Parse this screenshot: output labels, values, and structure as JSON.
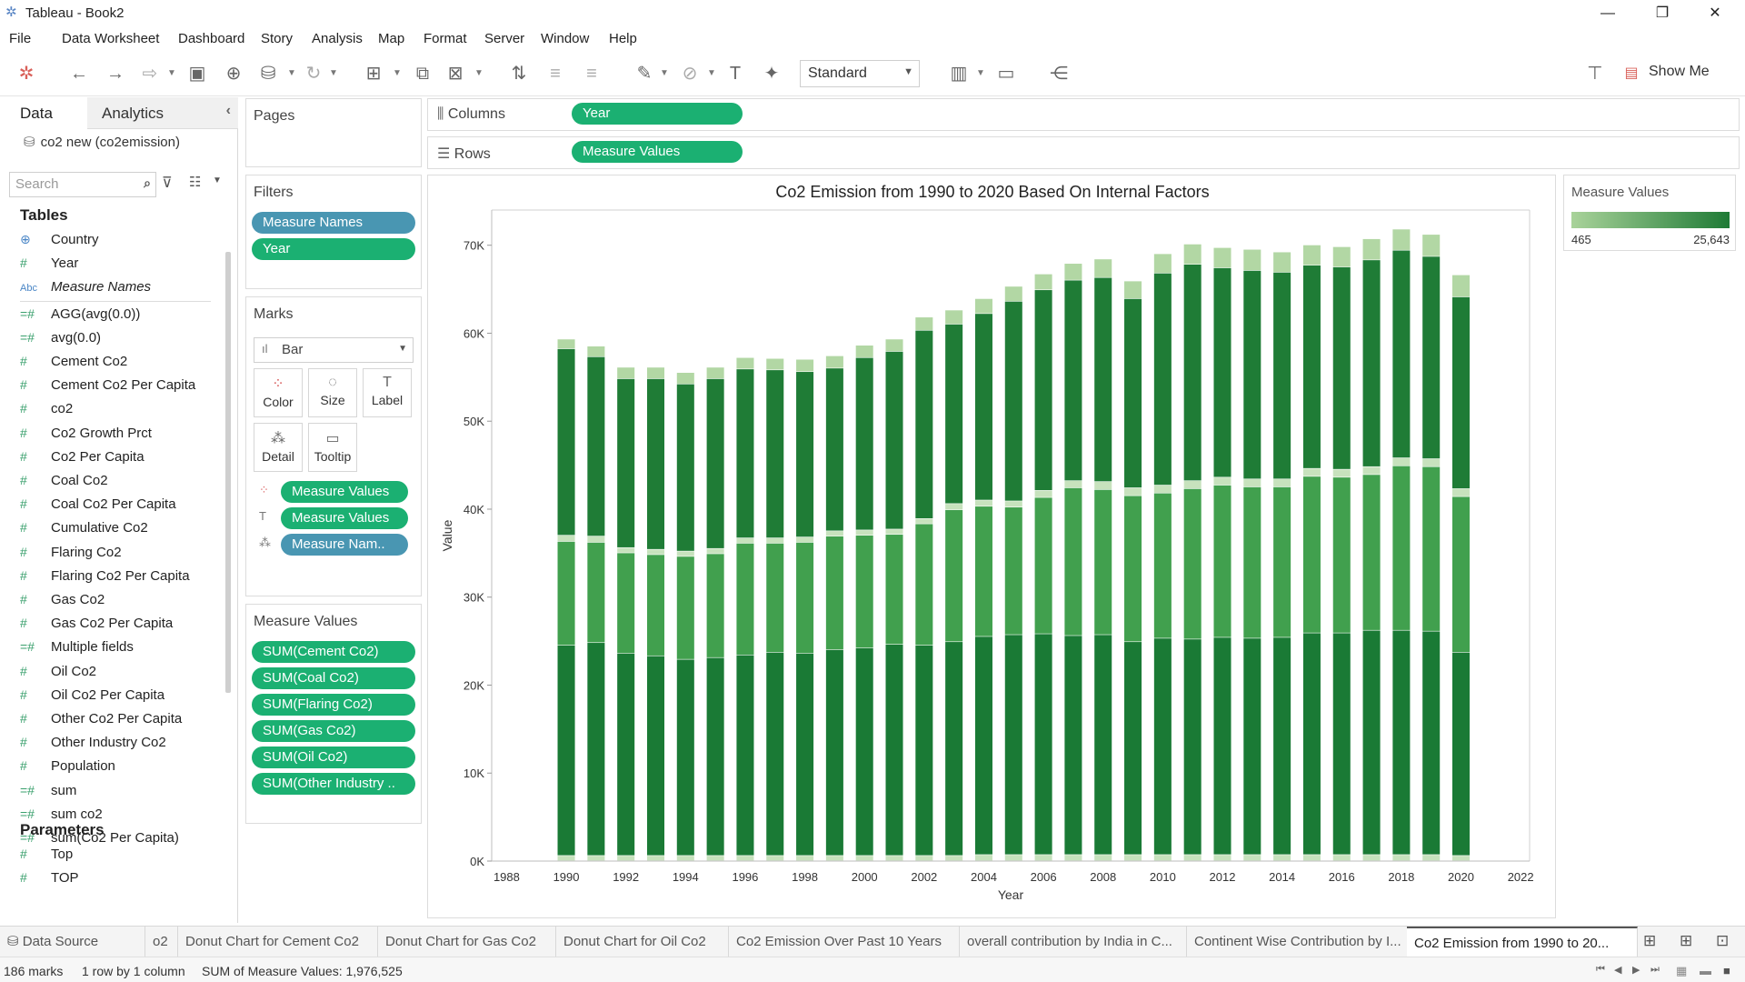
{
  "window": {
    "title": "Tableau - Book2",
    "minimize": "—",
    "restore": "❐",
    "close": "✕"
  },
  "menu": [
    "File",
    "Data",
    "Worksheet",
    "Dashboard",
    "Story",
    "Analysis",
    "Map",
    "Format",
    "Server",
    "Window",
    "Help"
  ],
  "toolbar": {
    "view_mode": "Standard",
    "show_me": "Show Me"
  },
  "left_pane": {
    "tabs": {
      "data": "Data",
      "analytics": "Analytics"
    },
    "datasource": "co2 new (co2emission)",
    "search_placeholder": "Search",
    "tables_heading": "Tables",
    "fields": [
      {
        "icon": "globe",
        "name": "Country"
      },
      {
        "icon": "#",
        "name": "Year"
      },
      {
        "icon": "Abc",
        "name": "Measure Names"
      },
      {
        "icon": "=#",
        "name": "AGG(avg(0.0))"
      },
      {
        "icon": "=#",
        "name": "avg(0.0)"
      },
      {
        "icon": "#",
        "name": "Cement Co2"
      },
      {
        "icon": "#",
        "name": "Cement Co2 Per Capita"
      },
      {
        "icon": "#",
        "name": "co2"
      },
      {
        "icon": "#",
        "name": "Co2 Growth Prct"
      },
      {
        "icon": "#",
        "name": "Co2 Per Capita"
      },
      {
        "icon": "#",
        "name": "Coal Co2"
      },
      {
        "icon": "#",
        "name": "Coal Co2 Per Capita"
      },
      {
        "icon": "#",
        "name": "Cumulative Co2"
      },
      {
        "icon": "#",
        "name": "Flaring Co2"
      },
      {
        "icon": "#",
        "name": "Flaring Co2 Per Capita"
      },
      {
        "icon": "#",
        "name": "Gas Co2"
      },
      {
        "icon": "#",
        "name": "Gas Co2 Per Capita"
      },
      {
        "icon": "=#",
        "name": "Multiple fields"
      },
      {
        "icon": "#",
        "name": "Oil Co2"
      },
      {
        "icon": "#",
        "name": "Oil Co2 Per Capita"
      },
      {
        "icon": "#",
        "name": "Other Co2 Per Capita"
      },
      {
        "icon": "#",
        "name": "Other Industry Co2"
      },
      {
        "icon": "#",
        "name": "Population"
      },
      {
        "icon": "=#",
        "name": "sum"
      },
      {
        "icon": "=#",
        "name": "sum co2"
      },
      {
        "icon": "=#",
        "name": "sum(Co2 Per Capita)"
      }
    ],
    "parameters_heading": "Parameters",
    "parameters": [
      {
        "icon": "#",
        "name": "Top"
      },
      {
        "icon": "#",
        "name": "TOP"
      }
    ]
  },
  "pages": {
    "title": "Pages"
  },
  "filters": {
    "title": "Filters",
    "pills": [
      "Measure Names",
      "Year"
    ]
  },
  "marks": {
    "title": "Marks",
    "type": "Bar",
    "buttons": [
      "Color",
      "Size",
      "Label",
      "Detail",
      "Tooltip"
    ],
    "pills": [
      "Measure Values",
      "Measure Values",
      "Measure Nam.."
    ]
  },
  "measure_values": {
    "title": "Measure Values",
    "pills": [
      "SUM(Cement Co2)",
      "SUM(Coal Co2)",
      "SUM(Flaring Co2)",
      "SUM(Gas Co2)",
      "SUM(Oil Co2)",
      "SUM(Other Industry .."
    ]
  },
  "shelves": {
    "columns_label": "Columns",
    "columns_pill": "Year",
    "rows_label": "Rows",
    "rows_pill": "Measure Values"
  },
  "legend": {
    "title": "Measure Values",
    "min": "465",
    "max": "25,643",
    "color_low": "#a9d39a",
    "color_high": "#1e7a35"
  },
  "chart_data": {
    "type": "bar",
    "title": "Co2 Emission from  1990 to 2020 Based On Internal Factors",
    "xlabel": "Year",
    "ylabel": "Value",
    "ylim": [
      0,
      74000
    ],
    "xlim": [
      1987.5,
      2022.3
    ],
    "x_ticks": [
      "1988",
      "1990",
      "1992",
      "1994",
      "1996",
      "1998",
      "2000",
      "2002",
      "2004",
      "2006",
      "2008",
      "2010",
      "2012",
      "2014",
      "2016",
      "2018",
      "2020",
      "2022"
    ],
    "y_ticks": [
      {
        "v": 0,
        "label": "0K"
      },
      {
        "v": 10000,
        "label": "10K"
      },
      {
        "v": 20000,
        "label": "20K"
      },
      {
        "v": 30000,
        "label": "30K"
      },
      {
        "v": 40000,
        "label": "40K"
      },
      {
        "v": 50000,
        "label": "50K"
      },
      {
        "v": 60000,
        "label": "60K"
      },
      {
        "v": 70000,
        "label": "70K"
      }
    ],
    "stack_order_bottom_to_top": [
      "Flaring Co2",
      "Oil Co2",
      "Gas Co2",
      "Other Industry Co2",
      "Coal Co2",
      "Cement Co2"
    ],
    "series_colors": [
      "#c7e2bd",
      "#1a7a35",
      "#41a04e",
      "#c7e2bd",
      "#1f7c36",
      "#b2d7a4"
    ],
    "years": [
      1990,
      1991,
      1992,
      1993,
      1994,
      1995,
      1996,
      1997,
      1998,
      1999,
      2000,
      2001,
      2002,
      2003,
      2004,
      2005,
      2006,
      2007,
      2008,
      2009,
      2010,
      2011,
      2012,
      2013,
      2014,
      2015,
      2016,
      2017,
      2018,
      2019,
      2020
    ],
    "segments_bottom_to_top": [
      [
        600,
        23900,
        11800,
        700,
        21200,
        1100
      ],
      [
        600,
        24200,
        11400,
        700,
        20400,
        1200
      ],
      [
        600,
        23000,
        11400,
        600,
        19200,
        1300
      ],
      [
        600,
        22700,
        11500,
        600,
        19400,
        1300
      ],
      [
        600,
        22300,
        11700,
        600,
        19000,
        1300
      ],
      [
        600,
        22500,
        11800,
        600,
        19300,
        1300
      ],
      [
        600,
        22800,
        12700,
        600,
        19200,
        1300
      ],
      [
        600,
        23100,
        12400,
        600,
        19100,
        1300
      ],
      [
        600,
        23000,
        12600,
        600,
        18800,
        1400
      ],
      [
        600,
        23400,
        12900,
        600,
        18500,
        1400
      ],
      [
        600,
        23600,
        12800,
        600,
        19600,
        1400
      ],
      [
        600,
        24000,
        12500,
        600,
        20200,
        1400
      ],
      [
        600,
        23900,
        13800,
        600,
        21400,
        1500
      ],
      [
        600,
        24300,
        15000,
        700,
        20400,
        1600
      ],
      [
        700,
        24800,
        14800,
        700,
        21200,
        1700
      ],
      [
        700,
        25000,
        14500,
        700,
        22700,
        1700
      ],
      [
        700,
        25100,
        15500,
        800,
        22800,
        1800
      ],
      [
        700,
        24900,
        16800,
        800,
        22800,
        1900
      ],
      [
        700,
        25000,
        16500,
        900,
        23200,
        2100
      ],
      [
        700,
        24200,
        16600,
        900,
        21500,
        2000
      ],
      [
        700,
        24600,
        16500,
        900,
        24100,
        2200
      ],
      [
        700,
        24500,
        17100,
        900,
        24600,
        2300
      ],
      [
        700,
        24700,
        17300,
        900,
        23800,
        2300
      ],
      [
        700,
        24600,
        17200,
        900,
        23700,
        2400
      ],
      [
        700,
        24700,
        17100,
        900,
        23500,
        2300
      ],
      [
        700,
        25200,
        17800,
        900,
        23100,
        2300
      ],
      [
        700,
        25200,
        17700,
        900,
        23000,
        2300
      ],
      [
        700,
        25500,
        17700,
        900,
        23500,
        2400
      ],
      [
        700,
        25500,
        18700,
        900,
        23600,
        2400
      ],
      [
        700,
        25400,
        18700,
        900,
        23000,
        2500
      ],
      [
        600,
        23100,
        17700,
        900,
        21800,
        2500
      ]
    ]
  },
  "sheet_tabs": [
    "Data Source",
    "o2",
    "Donut Chart for Cement Co2",
    "Donut Chart for Gas Co2",
    "Donut Chart for Oil Co2",
    "Co2 Emission Over Past 10 Years",
    "overall contribution by India in C...",
    "Continent Wise Contribution by I...",
    "Co2 Emission from  1990 to 20..."
  ],
  "status": {
    "marks": "186 marks",
    "dims": "1 row by 1 column",
    "sum": "SUM of Measure Values: 1,976,525"
  }
}
